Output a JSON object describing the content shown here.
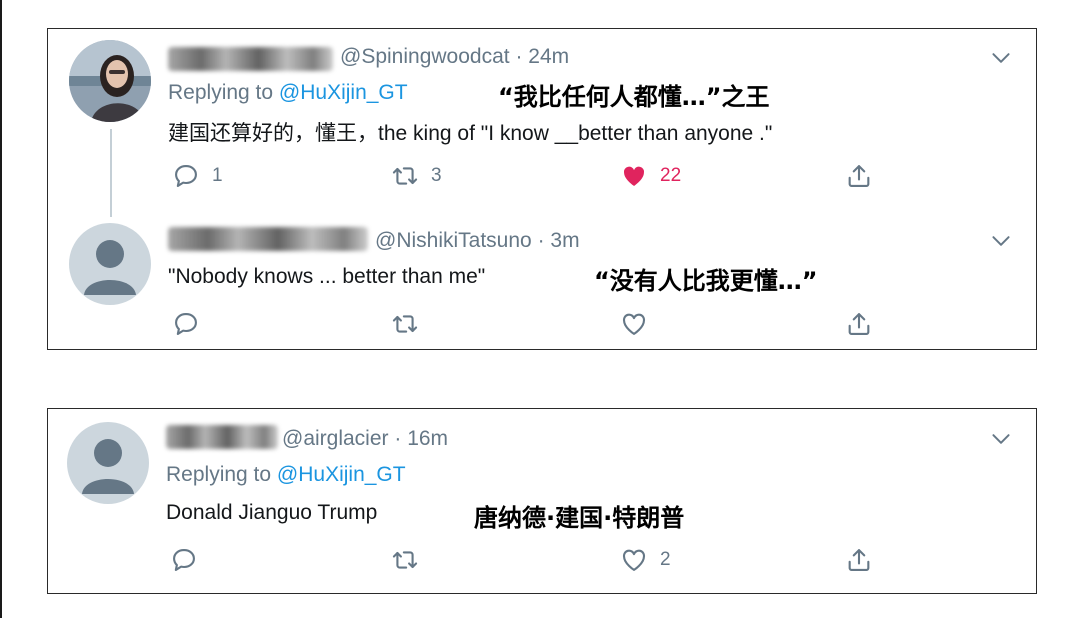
{
  "tweets": [
    {
      "handle": "@Spiningwoodcat",
      "time": "24m",
      "replying_prefix": "Replying to ",
      "replying_to": "@HuXijin_GT",
      "annotation": "“我比任何人都懂…”之王",
      "text": "建国还算好的，懂王，the king of \"I know __better than anyone .\"",
      "replies": "1",
      "retweets": "3",
      "likes": "22",
      "liked": true,
      "like_color": "#e0245e"
    },
    {
      "handle": "@NishikiTatsuno",
      "time": "3m",
      "text": "\"Nobody knows ... better than me\"",
      "annotation": "“没有人比我更懂…”"
    },
    {
      "handle": "@airglacier",
      "time": "16m",
      "replying_prefix": "Replying to ",
      "replying_to": "@HuXijin_GT",
      "text": "Donald Jianguo Trump",
      "annotation": "唐纳德·建国·特朗普",
      "likes": "2"
    }
  ],
  "colors": {
    "mention": "#1b95e0",
    "muted": "#657786",
    "text": "#14171a"
  },
  "icons": [
    "reply-icon",
    "retweet-icon",
    "like-icon",
    "share-icon",
    "chevron-down-icon"
  ]
}
